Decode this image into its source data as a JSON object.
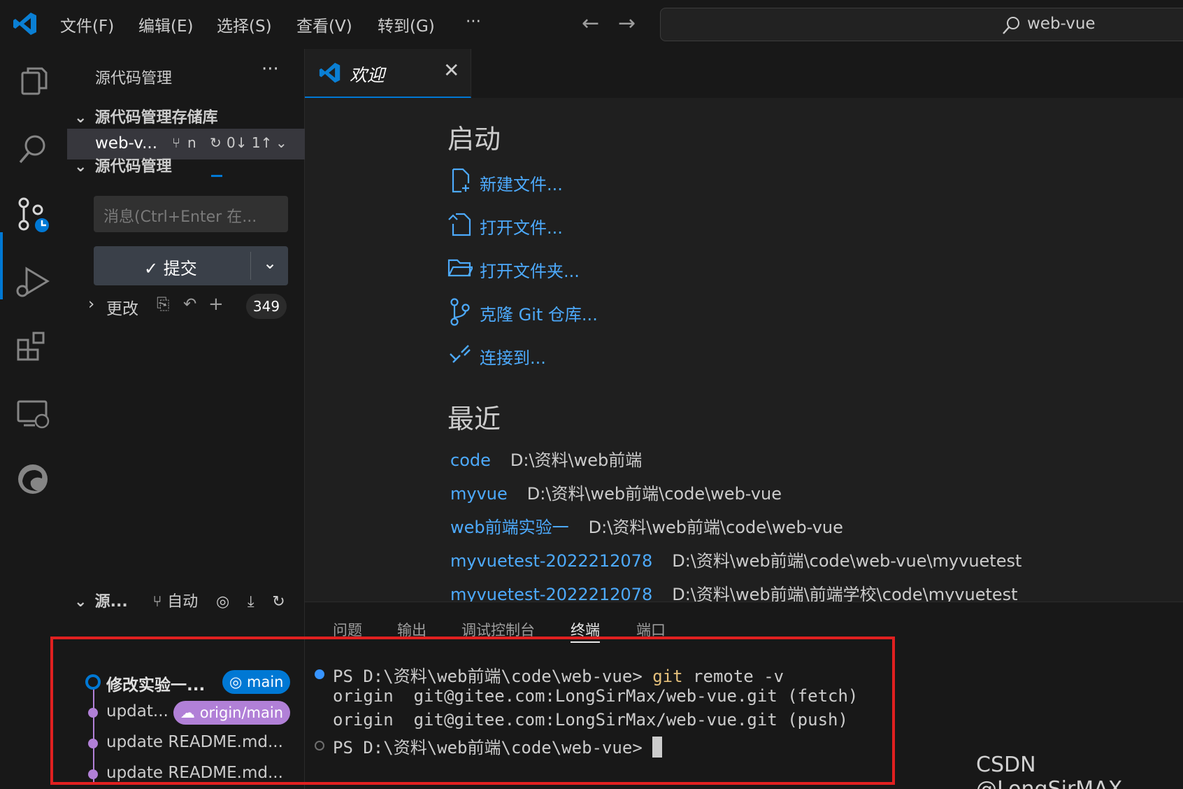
{
  "titlebar": {
    "menus": [
      "文件(F)",
      "编辑(E)",
      "选择(S)",
      "查看(V)",
      "转到(G)",
      "···"
    ],
    "search_text": "web-vue",
    "back_icon": "arrow-left-icon",
    "forward_icon": "arrow-right-icon"
  },
  "activity_bar": [
    "explorer-icon",
    "search-icon",
    "source-control-icon",
    "run-debug-icon",
    "extensions-icon",
    "remote-explorer-icon",
    "edge-icon"
  ],
  "sidebar": {
    "title": "源代码管理",
    "more": "···",
    "repos_header": "源代码管理存储库",
    "repo": {
      "name": "web-v...",
      "branch": "n",
      "sync": "0↓ 1↑"
    },
    "scm_header": "源代码管理",
    "message_placeholder": "消息(Ctrl+Enter 在...",
    "commit_label": "✓ 提交",
    "changes_label": "更改",
    "changes_count": "349",
    "graph": {
      "header": "源...",
      "auto": "自动",
      "items": [
        {
          "message": "修改实验一...",
          "ref": "main"
        },
        {
          "message": "updat...",
          "ref": "origin/main"
        },
        {
          "message": "update README.md...",
          "ref": ""
        },
        {
          "message": "update README.md...",
          "ref": ""
        }
      ]
    }
  },
  "editor": {
    "tab_title": "欢迎",
    "start_heading": "启动",
    "start_items": [
      "新建文件...",
      "打开文件...",
      "打开文件夹...",
      "克隆 Git 仓库...",
      "连接到..."
    ],
    "recent_heading": "最近",
    "recent": [
      {
        "name": "code",
        "path": "D:\\资料\\web前端"
      },
      {
        "name": "myvue",
        "path": "D:\\资料\\web前端\\code\\web-vue"
      },
      {
        "name": "web前端实验一",
        "path": "D:\\资料\\web前端\\code\\web-vue"
      },
      {
        "name": "myvuetest-2022212078",
        "path": "D:\\资料\\web前端\\code\\web-vue\\myvuetest"
      },
      {
        "name": "myvuetest-2022212078",
        "path": "D:\\资料\\web前端\\前端学校\\code\\myvuetest"
      }
    ]
  },
  "panel": {
    "tabs": [
      "问题",
      "输出",
      "调试控制台",
      "终端",
      "端口"
    ],
    "active_tab": "终端",
    "terminal": {
      "prompt1": "PS D:\\资料\\web前端\\code\\web-vue> ",
      "cmd_git": "git",
      "cmd_rest": " remote -v",
      "line2": "origin  git@gitee.com:LongSirMax/web-vue.git (fetch)",
      "line3": "origin  git@gitee.com:LongSirMax/web-vue.git (push)",
      "prompt2": "PS D:\\资料\\web前端\\code\\web-vue> "
    }
  },
  "watermark": "CSDN @LongSirMAX",
  "colors": {
    "accent": "#0078d4",
    "link": "#4daafc",
    "highlight_box": "#e02020",
    "graph": "#b180d7"
  }
}
